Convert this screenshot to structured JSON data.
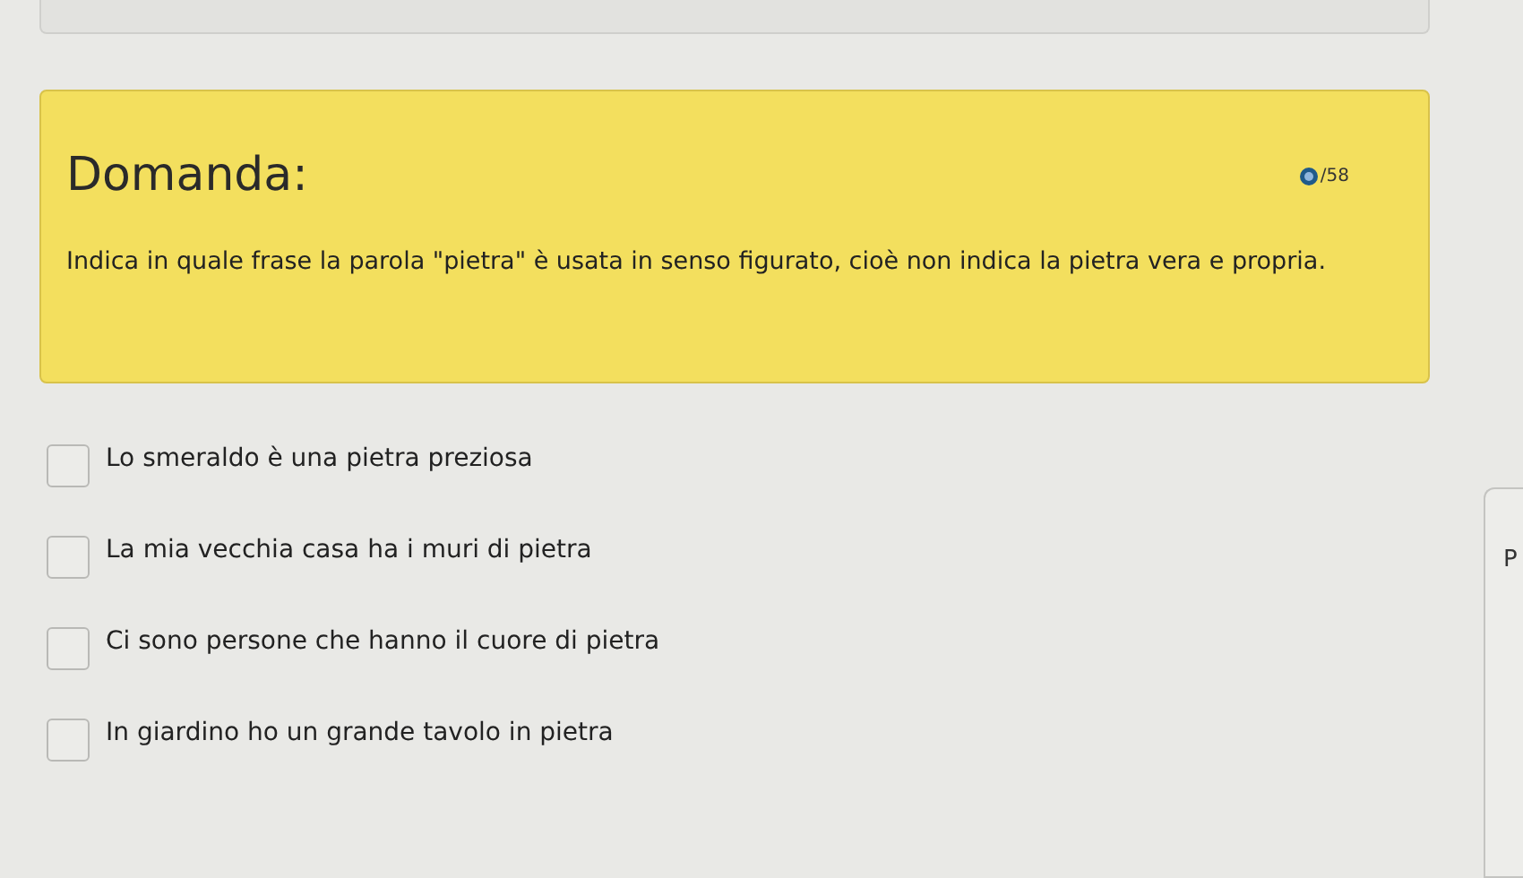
{
  "question": {
    "title": "Domanda:",
    "counter": "/58",
    "text": "Indica in quale frase la parola \"pietra\" è usata in senso figurato, cioè non indica la pietra vera e propria."
  },
  "options": [
    {
      "label": "Lo smeraldo è una pietra preziosa",
      "checked": false
    },
    {
      "label": "La mia vecchia casa ha i muri di pietra",
      "checked": false
    },
    {
      "label": "Ci sono persone che hanno il cuore di pietra",
      "checked": false
    },
    {
      "label": "In giardino ho un grande tavolo in pietra",
      "checked": false
    }
  ],
  "side_panel": {
    "text": "P"
  }
}
